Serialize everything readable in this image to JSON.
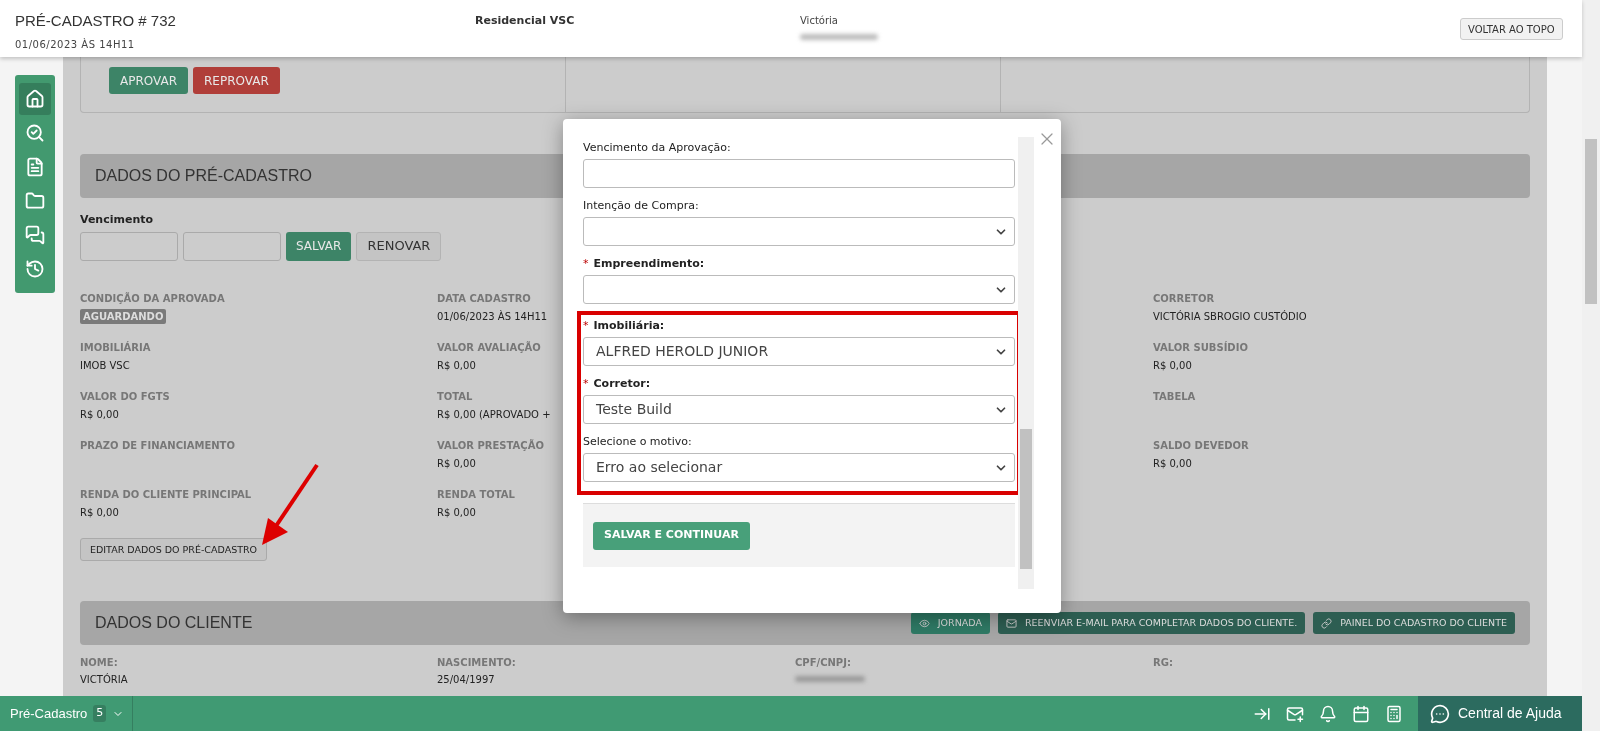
{
  "header": {
    "title": "PRÉ-CADASTRO # 732",
    "date": "01/06/2023 ÀS 14H11",
    "project": "Residencial VSC",
    "client": "Victória",
    "back_to_top": "VOLTAR AO TOPO"
  },
  "sidebar": {
    "items": [
      {
        "kind": "home",
        "selected": true
      },
      {
        "kind": "money-search",
        "selected": false
      },
      {
        "kind": "document",
        "selected": false
      },
      {
        "kind": "folder",
        "selected": false
      },
      {
        "kind": "chat",
        "selected": false
      },
      {
        "kind": "history",
        "selected": false
      }
    ]
  },
  "approval": {
    "buttons": [
      {
        "label": "APROVAR",
        "kind": "approve"
      },
      {
        "label": "REPROVAR",
        "kind": "reject"
      }
    ]
  },
  "pre_cadastro": {
    "title": "DADOS DO PRÉ-CADASTRO",
    "vencimento_label": "Vencimento",
    "save": "SALVAR",
    "renew": "RENOVAR",
    "rows": [
      [
        {
          "label": "CONDIÇÃO DA APROVADA",
          "value": "AGUARDANDO",
          "kind": "badge"
        },
        {
          "label": "DATA CADASTRO",
          "value": "01/06/2023 ÀS 14H11"
        },
        {
          "label": "CORRETOR",
          "value": "VICTÓRIA SBROGIO CUSTÓDIO"
        }
      ],
      [
        {
          "label": "IMOBILIÁRIA",
          "value": "IMOB VSC"
        },
        {
          "label": "VALOR AVALIAÇÃO",
          "value": "R$ 0,00"
        },
        {
          "label": "VALOR SUBSÍDIO",
          "value": "R$ 0,00"
        }
      ],
      [
        {
          "label": "VALOR DO FGTS",
          "value": "R$ 0,00"
        },
        {
          "label": "TOTAL",
          "value": "R$ 0,00 (APROVADO +"
        },
        {
          "label": "TABELA"
        }
      ],
      [
        {
          "label": "PRAZO DE FINANCIAMENTO"
        },
        {
          "label": "VALOR PRESTAÇÃO",
          "value": "R$ 0,00"
        },
        {
          "label": "SALDO DEVEDOR",
          "value": "R$ 0,00"
        }
      ],
      [
        {
          "label": "RENDA DO CLIENTE PRINCIPAL",
          "value": "R$ 0,00"
        },
        {
          "label": "RENDA TOTAL",
          "value": "R$ 0,00"
        }
      ]
    ],
    "edit_button": "EDITAR DADOS DO PRÉ-CADASTRO"
  },
  "cliente": {
    "title": "DADOS DO CLIENTE",
    "buttons": [
      {
        "label": "JORNADA",
        "kind": "journey"
      },
      {
        "label": "REENVIAR E-MAIL PARA COMPLETAR DADOS DO CLIENTE.",
        "kind": "email"
      },
      {
        "label": "PAINEL DO CADASTRO DO CLIENTE",
        "kind": "link"
      }
    ],
    "fields": [
      {
        "label": "NOME:",
        "value": "VICTÓRIA"
      },
      {
        "label": "NASCIMENTO:",
        "value": "25/04/1997"
      },
      {
        "label": "CPF/CNPJ:",
        "kind": "blurred"
      },
      {
        "label": "RG:"
      }
    ]
  },
  "modal": {
    "field_groups": [
      {
        "highlighted": false,
        "fields": [
          {
            "label": "Vencimento da Aprovação:",
            "kind": "text"
          },
          {
            "label": "Intenção de Compra:",
            "kind": "select"
          },
          {
            "label": "Empreendimento:",
            "required_mark": "*",
            "kind": "select"
          }
        ]
      },
      {
        "highlighted": true,
        "fields": [
          {
            "label": "Imobiliária:",
            "required_mark": "*",
            "kind": "select",
            "value": "ALFRED HEROLD JUNIOR"
          },
          {
            "label": "Corretor:",
            "required_mark": "*",
            "kind": "select",
            "value": "Teste Build"
          },
          {
            "label": "Selecione o motivo:",
            "kind": "select",
            "value": "Erro ao selecionar"
          }
        ]
      }
    ],
    "submit": "SALVAR E CONTINUAR"
  },
  "footer": {
    "module": "Pré-Cadastro",
    "count": "5",
    "icons": [
      {
        "kind": "collapse"
      },
      {
        "kind": "mail-star"
      },
      {
        "kind": "bell"
      },
      {
        "kind": "calendar"
      },
      {
        "kind": "calculator"
      }
    ],
    "help": "Central de Ajuda"
  }
}
